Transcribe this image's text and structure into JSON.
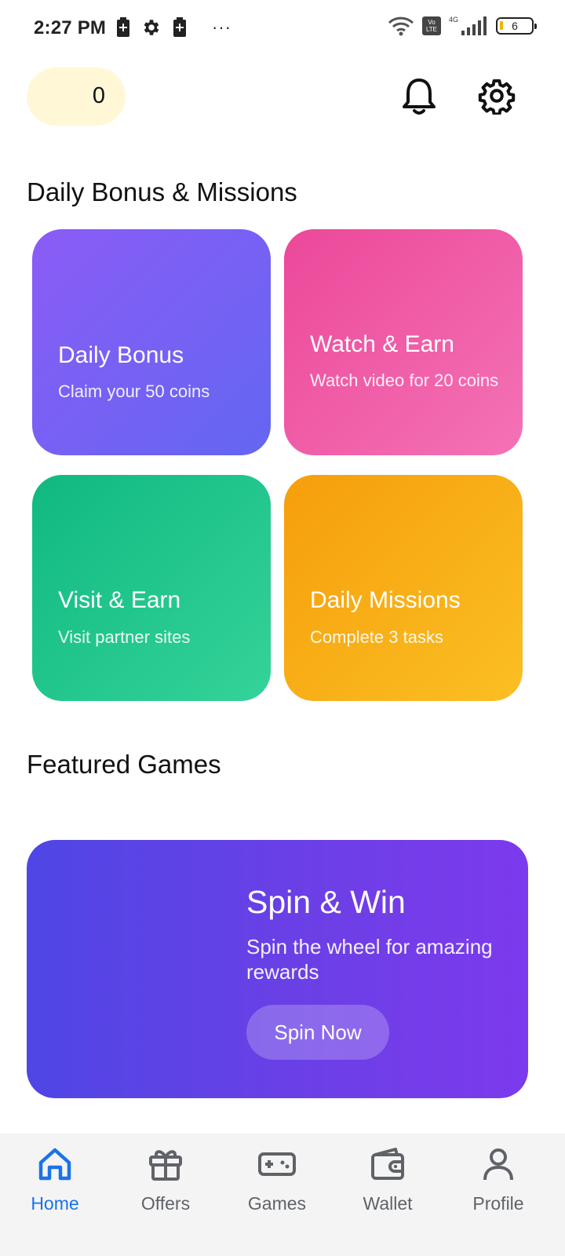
{
  "status_bar": {
    "time": "2:27 PM",
    "more": "···",
    "network": "4G",
    "volte": "Vo LTE",
    "battery": "6"
  },
  "header": {
    "coins": "0"
  },
  "sections": {
    "daily_title": "Daily Bonus & Missions",
    "featured_title": "Featured Games"
  },
  "cards": [
    {
      "title": "Daily Bonus",
      "subtitle": "Claim your 50 coins"
    },
    {
      "title": "Watch & Earn",
      "subtitle": "Watch video for 20 coins"
    },
    {
      "title": "Visit & Earn",
      "subtitle": "Visit partner sites"
    },
    {
      "title": "Daily Missions",
      "subtitle": "Complete 3 tasks"
    }
  ],
  "featured": {
    "title": "Spin & Win",
    "subtitle": "Spin the wheel for amazing rewards",
    "button": "Spin Now"
  },
  "nav": [
    {
      "label": "Home",
      "icon": "home-icon",
      "active": true
    },
    {
      "label": "Offers",
      "icon": "gift-icon",
      "active": false
    },
    {
      "label": "Games",
      "icon": "gamepad-icon",
      "active": false
    },
    {
      "label": "Wallet",
      "icon": "wallet-icon",
      "active": false
    },
    {
      "label": "Profile",
      "icon": "person-icon",
      "active": false
    }
  ],
  "colors": {
    "accent": "#1a73e8",
    "coin_pill": "#fff7d6",
    "daily_bonus": "#7c5cf5",
    "watch_earn": "#ef5aa5",
    "visit_earn": "#22c58b",
    "daily_missions": "#f7ab1a",
    "spin_win": "#5f45e8"
  }
}
